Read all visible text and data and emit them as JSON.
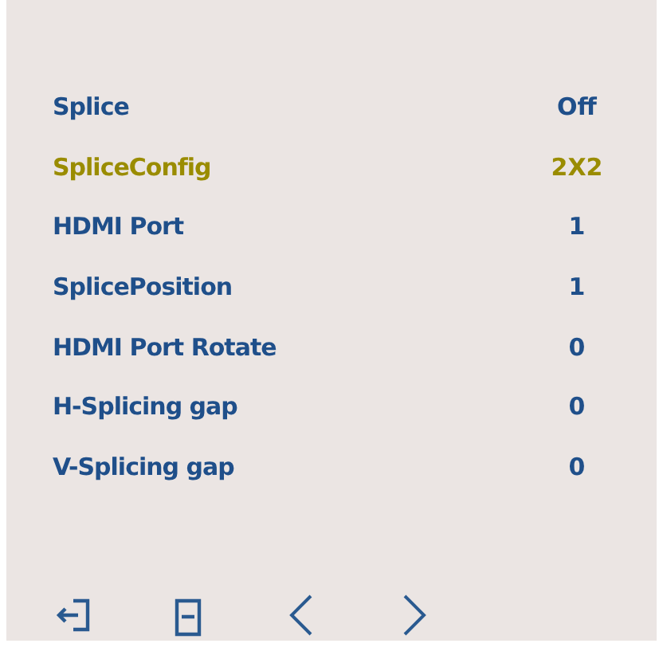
{
  "menu": [
    {
      "label": "Splice",
      "value": "Off",
      "selected": false
    },
    {
      "label": "SpliceConfig",
      "value": "2X2",
      "selected": true
    },
    {
      "label": "HDMI Port",
      "value": "1",
      "selected": false
    },
    {
      "label": "SplicePosition",
      "value": "1",
      "selected": false
    },
    {
      "label": "HDMI Port Rotate",
      "value": "0",
      "selected": false
    },
    {
      "label": "H-Splicing gap",
      "value": "0",
      "selected": false
    },
    {
      "label": "V-Splicing gap",
      "value": "0",
      "selected": false
    }
  ],
  "toolbar": [
    {
      "kind": "exit"
    },
    {
      "kind": "menu"
    },
    {
      "kind": "left"
    },
    {
      "kind": "right"
    }
  ]
}
